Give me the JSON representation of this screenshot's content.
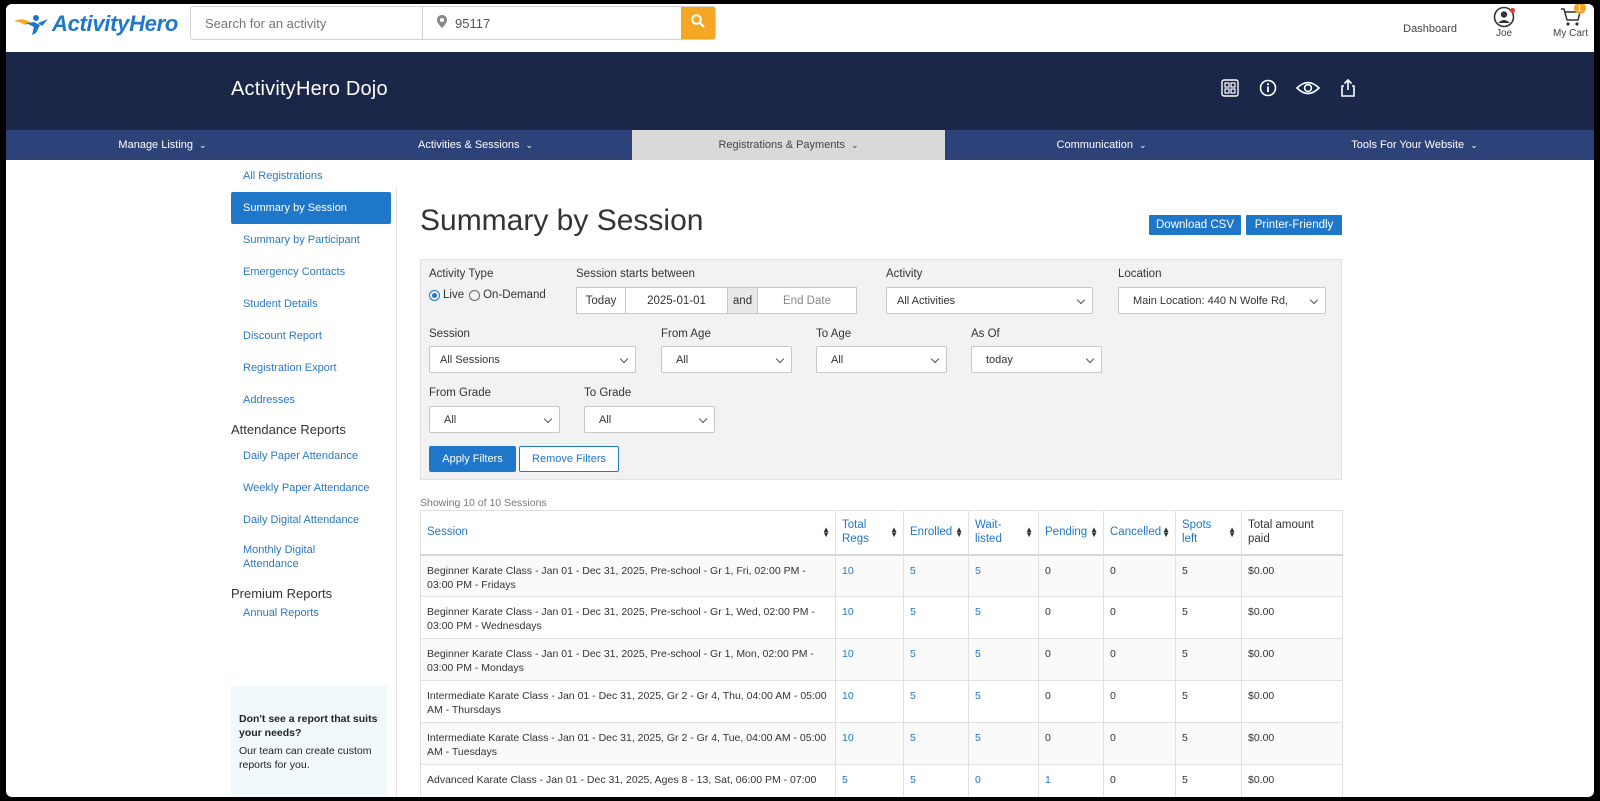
{
  "topbar": {
    "logo_text": "ActivityHero",
    "search_placeholder": "Search for an activity",
    "zip_value": "95117",
    "dashboard_label": "Dashboard",
    "user_label": "Joe",
    "cart_label": "My Cart",
    "cart_count": "1"
  },
  "header": {
    "title": "ActivityHero Dojo"
  },
  "nav": [
    {
      "label": "Manage Listing"
    },
    {
      "label": "Activities & Sessions"
    },
    {
      "label": "Registrations & Payments"
    },
    {
      "label": "Communication"
    },
    {
      "label": "Tools For Your Website"
    }
  ],
  "sidebar": {
    "items": [
      {
        "label": "All Registrations"
      },
      {
        "label": "Summary by Session"
      },
      {
        "label": "Summary by Participant"
      },
      {
        "label": "Emergency Contacts"
      },
      {
        "label": "Student Details"
      },
      {
        "label": "Discount Report"
      },
      {
        "label": "Registration Export"
      },
      {
        "label": "Addresses"
      }
    ],
    "attendance_heading": "Attendance Reports",
    "attendance_items": [
      {
        "label": "Daily Paper Attendance"
      },
      {
        "label": "Weekly Paper Attendance"
      },
      {
        "label": "Daily Digital Attendance"
      },
      {
        "label": "Monthly Digital Attendance"
      }
    ],
    "premium_heading": "Premium Reports",
    "premium_items": [
      {
        "label": "Annual Reports"
      }
    ],
    "help_title": "Don't see a report that suits your needs?",
    "help_text": "Our team can create custom reports for you."
  },
  "main": {
    "title": "Summary by Session",
    "download_csv": "Download CSV",
    "printer_friendly": "Printer-Friendly",
    "filters": {
      "activity_type_label": "Activity Type",
      "live_label": "Live",
      "on_demand_label": "On-Demand",
      "session_starts_label": "Session starts between",
      "today_label": "Today",
      "start_date": "2025-01-01",
      "and_label": "and",
      "end_date_placeholder": "End Date",
      "activity_label": "Activity",
      "activity_value": "All Activities",
      "location_label": "Location",
      "location_value": "Main Location: 440 N Wolfe Rd,",
      "session_label": "Session",
      "session_value": "All Sessions",
      "from_age_label": "From Age",
      "from_age_value": "All",
      "to_age_label": "To Age",
      "to_age_value": "All",
      "as_of_label": "As Of",
      "as_of_value": "today",
      "from_grade_label": "From Grade",
      "from_grade_value": "All",
      "to_grade_label": "To Grade",
      "to_grade_value": "All",
      "apply_label": "Apply Filters",
      "remove_label": "Remove Filters"
    },
    "showing_text": "Showing 10 of 10 Sessions",
    "table": {
      "headers": [
        "Session",
        "Total Regs",
        "Enrolled",
        "Wait-listed",
        "Pending",
        "Cancelled",
        "Spots left",
        "Total amount paid"
      ],
      "rows": [
        [
          "Beginner Karate Class - Jan 01 - Dec 31, 2025, Pre-school - Gr 1, Fri, 02:00 PM - 03:00 PM - Fridays",
          "10",
          "5",
          "5",
          "0",
          "0",
          "5",
          "$0.00"
        ],
        [
          "Beginner Karate Class - Jan 01 - Dec 31, 2025, Pre-school - Gr 1, Wed, 02:00 PM - 03:00 PM - Wednesdays",
          "10",
          "5",
          "5",
          "0",
          "0",
          "5",
          "$0.00"
        ],
        [
          "Beginner Karate Class - Jan 01 - Dec 31, 2025, Pre-school - Gr 1, Mon, 02:00 PM - 03:00 PM - Mondays",
          "10",
          "5",
          "5",
          "0",
          "0",
          "5",
          "$0.00"
        ],
        [
          "Intermediate Karate Class - Jan 01 - Dec 31, 2025, Gr 2 - Gr 4, Thu, 04:00 AM - 05:00 AM - Thursdays",
          "10",
          "5",
          "5",
          "0",
          "0",
          "5",
          "$0.00"
        ],
        [
          "Intermediate Karate Class - Jan 01 - Dec 31, 2025, Gr 2 - Gr 4, Tue, 04:00 AM - 05:00 AM - Tuesdays",
          "10",
          "5",
          "5",
          "0",
          "0",
          "5",
          "$0.00"
        ],
        [
          "Advanced Karate Class - Jan 01 - Dec 31, 2025, Ages 8 - 13, Sat, 06:00 PM - 07:00",
          "5",
          "5",
          "0",
          "1",
          "0",
          "5",
          "$0.00"
        ]
      ]
    }
  },
  "colors": {
    "brand_blue": "#1f77c9",
    "header_navy": "#1b2748",
    "nav_blue": "#2d4279",
    "search_orange": "#f5a623"
  },
  "icons": [
    "location-pin-icon",
    "search-icon",
    "user-icon",
    "cart-icon",
    "qr-code-icon",
    "info-icon",
    "eye-icon",
    "share-icon",
    "chevron-down-icon",
    "sort-icon"
  ]
}
